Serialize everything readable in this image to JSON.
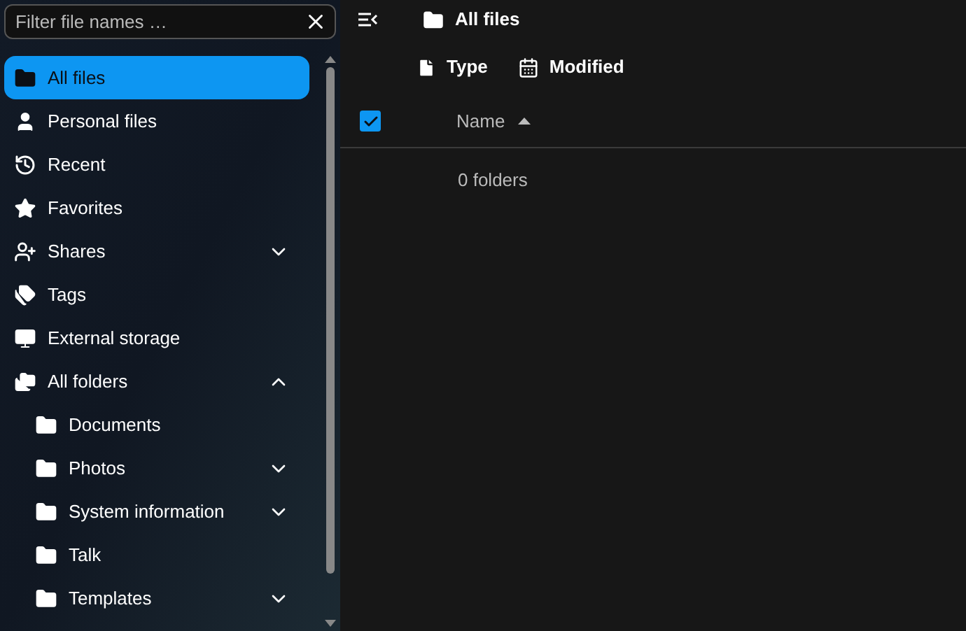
{
  "filter": {
    "placeholder": "Filter file names …"
  },
  "navigation": [
    {
      "label": "All files",
      "selected": true
    },
    {
      "label": "Personal files",
      "selected": false
    },
    {
      "label": "Recent",
      "selected": false
    },
    {
      "label": "Favorites",
      "selected": false
    },
    {
      "label": "Shares",
      "selected": false,
      "expanded": false
    },
    {
      "label": "Tags",
      "selected": false
    },
    {
      "label": "External storage",
      "selected": false
    },
    {
      "label": "All folders",
      "selected": false,
      "expanded": true,
      "children": [
        {
          "label": "Documents",
          "selected": false
        },
        {
          "label": "Photos",
          "selected": false,
          "expanded": false
        },
        {
          "label": "System information",
          "selected": false,
          "expanded": false
        },
        {
          "label": "Talk",
          "selected": false
        },
        {
          "label": "Templates",
          "selected": false,
          "expanded": false
        }
      ]
    }
  ],
  "breadcrumb": "All files",
  "filters": [
    "Type",
    "Modified"
  ],
  "table": {
    "select_all_checked": true,
    "columns": [
      {
        "label": "Name",
        "sorted_ascending": true
      }
    ],
    "summary": "0 folders"
  }
}
